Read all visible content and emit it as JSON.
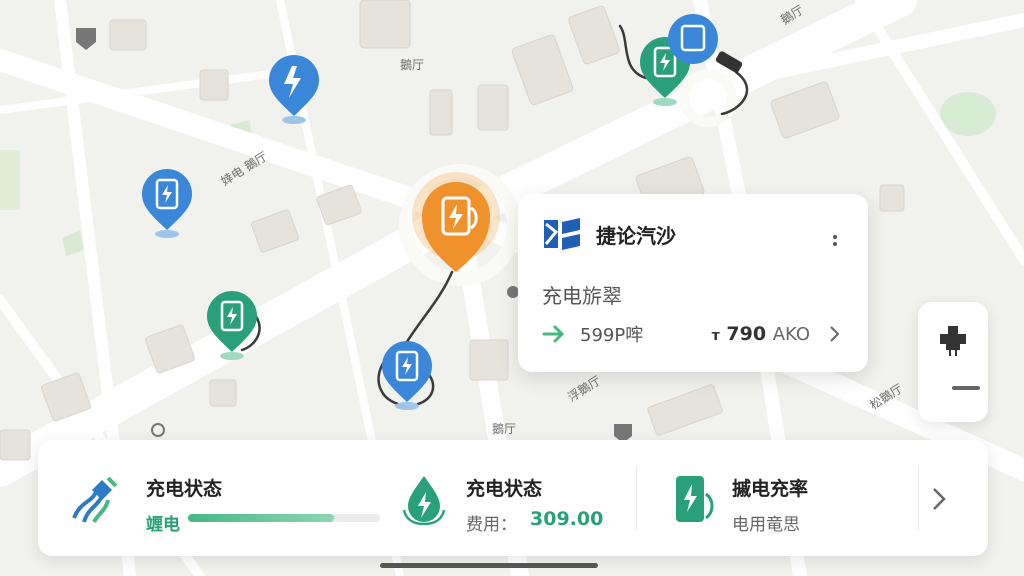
{
  "map": {
    "labels": [
      "鵝厅",
      "鵝厅",
      "婞电 鵝厅",
      "浮鵝厅",
      "鵝厅",
      "鵝厅",
      "松鵝厅"
    ]
  },
  "station_card": {
    "name": "捷论汽沙",
    "subtitle": "充电旂翠",
    "power": "599P哰",
    "price_symbol": "ᴛ",
    "price_value": "790",
    "price_unit": "AKO"
  },
  "status_panel": {
    "section1": {
      "title": "充电状态",
      "sub": "竰电",
      "progress": 0.76
    },
    "section2": {
      "title": "充电状态",
      "fee_label": "费用：",
      "fee_value": "309.00"
    },
    "section3": {
      "title": "摵电充率",
      "sub": "电用竜思"
    }
  },
  "colors": {
    "blue": "#3a86d8",
    "green": "#2aa07a",
    "orange": "#f0922c",
    "accent_green": "#45b884"
  },
  "icons": [
    "bolt-icon",
    "charger-icon",
    "plug-icon",
    "water-drop-icon",
    "battery-icon",
    "chevron-right-icon",
    "more-vertical-icon",
    "arrow-right-icon",
    "brand-logo",
    "minus-icon"
  ]
}
